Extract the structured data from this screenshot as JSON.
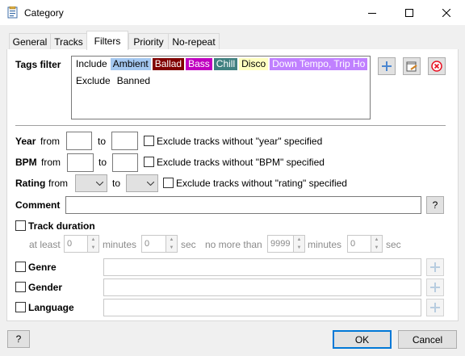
{
  "window": {
    "title": "Category",
    "minimize_icon": "minimize-icon",
    "maximize_icon": "maximize-icon",
    "close_icon": "close-icon"
  },
  "tabs": [
    {
      "label": "General",
      "active": false
    },
    {
      "label": "Tracks",
      "active": false
    },
    {
      "label": "Filters",
      "active": true
    },
    {
      "label": "Priority",
      "active": false
    },
    {
      "label": "No-repeat",
      "active": false
    }
  ],
  "tags_filter": {
    "label": "Tags filter",
    "include_label": "Include",
    "include_tags": [
      {
        "text": "Ambient",
        "bg": "#a4c8f0",
        "fg": "#000000"
      },
      {
        "text": "Ballad",
        "bg": "#800000",
        "fg": "#ffffff"
      },
      {
        "text": "Bass",
        "bg": "#c000c0",
        "fg": "#ffffff"
      },
      {
        "text": "Chill",
        "bg": "#408080",
        "fg": "#ffffff"
      },
      {
        "text": "Disco",
        "bg": "#ffffc0",
        "fg": "#000000"
      },
      {
        "text": "Down Tempo, Trip Ho",
        "bg": "#c080ff",
        "fg": "#ffffff"
      }
    ],
    "exclude_label": "Exclude",
    "exclude_tags": [
      {
        "text": "Banned"
      }
    ]
  },
  "year": {
    "label": "Year",
    "from": "from",
    "to": "to",
    "exclude": "Exclude tracks without \"year\" specified"
  },
  "bpm": {
    "label": "BPM",
    "from": "from",
    "to": "to",
    "exclude": "Exclude tracks without \"BPM\" specified"
  },
  "rating": {
    "label": "Rating",
    "from": "from",
    "to": "to",
    "exclude": "Exclude tracks without \"rating\" specified"
  },
  "comment": {
    "label": "Comment",
    "value": "",
    "help": "?"
  },
  "duration": {
    "label": "Track duration",
    "at_least": "at least",
    "min_minutes": "0",
    "min_seconds": "0",
    "minutes_label": "minutes",
    "sec_label": "sec",
    "no_more_than": "no more than",
    "max_minutes": "9999",
    "max_seconds": "0"
  },
  "genre": {
    "label": "Genre",
    "value": ""
  },
  "gender": {
    "label": "Gender",
    "value": ""
  },
  "language": {
    "label": "Language",
    "value": ""
  },
  "footer": {
    "help": "?",
    "ok": "OK",
    "cancel": "Cancel"
  },
  "colors": {
    "accent": "#0078d7",
    "remove": "#e81123"
  }
}
